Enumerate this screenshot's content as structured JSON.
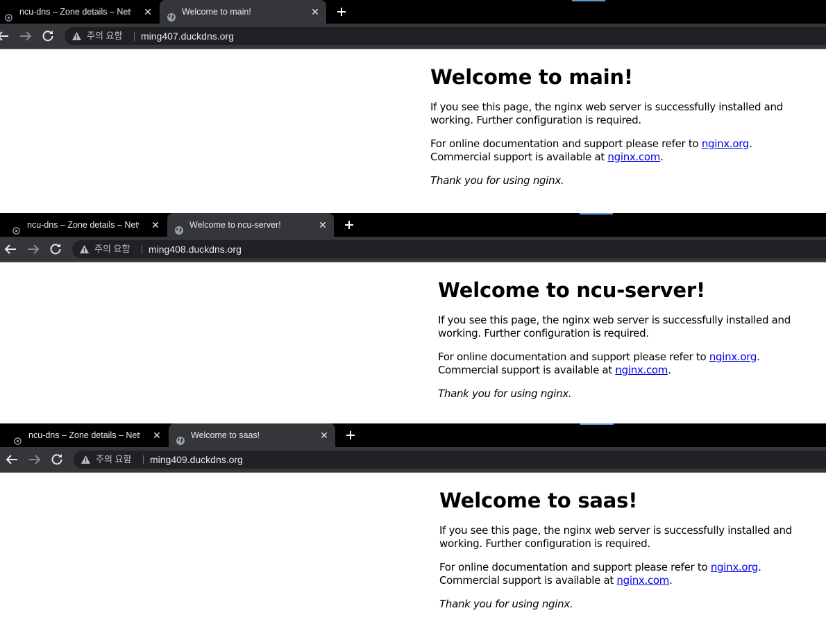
{
  "windows": [
    {
      "tabs": {
        "inactive": {
          "title": "ncu-dns – Zone details – Network services"
        },
        "active": {
          "title": "Welcome to main!"
        }
      },
      "omnibox": {
        "security_label": "주의 요함",
        "url": "ming407.duckdns.org"
      },
      "page": {
        "heading": "Welcome to main!",
        "paragraph1": "If you see this page, the nginx web server is successfully installed and working. Further configuration is required.",
        "paragraph2_before": "For online documentation and support please refer to ",
        "link_org": "nginx.org",
        "paragraph2_mid": ".",
        "paragraph2_line2": "Commercial support is available at ",
        "link_com": "nginx.com",
        "paragraph2_end": ".",
        "thanks": "Thank you for using nginx."
      }
    },
    {
      "tabs": {
        "inactive": {
          "title": "ncu-dns – Zone details – Network services"
        },
        "active": {
          "title": "Welcome to ncu-server!"
        }
      },
      "omnibox": {
        "security_label": "주의 요함",
        "url": "ming408.duckdns.org"
      },
      "page": {
        "heading": "Welcome to ncu-server!",
        "paragraph1": "If you see this page, the nginx web server is successfully installed and working. Further configuration is required.",
        "paragraph2_before": "For online documentation and support please refer to ",
        "link_org": "nginx.org",
        "paragraph2_mid": ".",
        "paragraph2_line2": "Commercial support is available at ",
        "link_com": "nginx.com",
        "paragraph2_end": ".",
        "thanks": "Thank you for using nginx."
      }
    },
    {
      "tabs": {
        "inactive": {
          "title": "ncu-dns – Zone details – Network services"
        },
        "active": {
          "title": "Welcome to saas!"
        }
      },
      "omnibox": {
        "security_label": "주의 요함",
        "url": "ming409.duckdns.org"
      },
      "page": {
        "heading": "Welcome to saas!",
        "paragraph1": "If you see this page, the nginx web server is successfully installed and working. Further configuration is required.",
        "paragraph2_before": "For online documentation and support please refer to ",
        "link_org": "nginx.org",
        "paragraph2_mid": ".",
        "paragraph2_line2": "Commercial support is available at ",
        "link_com": "nginx.com",
        "paragraph2_end": ".",
        "thanks": "Thank you for using nginx."
      }
    }
  ],
  "icons": {
    "inactive_tab": "gear-icon",
    "active_tab": "globe-icon",
    "close": "close-icon",
    "new_tab": "plus-icon",
    "back": "back-arrow-icon",
    "forward": "forward-arrow-icon",
    "reload": "reload-icon",
    "security": "warning-triangle-icon"
  },
  "colors": {
    "tab_strip": "#000000",
    "active_tab": "#35363a",
    "omnibox": "#202124",
    "link": "#0000ee"
  }
}
